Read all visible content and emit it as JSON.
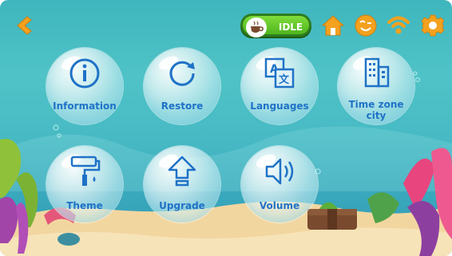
{
  "status": {
    "label": "IDLE",
    "icon": "tea-cup-icon"
  },
  "topbar": {
    "back_icon": "back-chevron-icon",
    "icons": [
      "home-icon",
      "face-icon",
      "wifi-icon",
      "gear-icon"
    ]
  },
  "menu": {
    "items": [
      {
        "label": "Information",
        "icon": "info-icon"
      },
      {
        "label": "Restore",
        "icon": "refresh-icon"
      },
      {
        "label": "Languages",
        "icon": "translate-icon"
      },
      {
        "label": "Time zone city",
        "icon": "building-icon"
      },
      {
        "label": "Theme",
        "icon": "paint-roller-icon"
      },
      {
        "label": "Upgrade",
        "icon": "upgrade-arrow-icon"
      },
      {
        "label": "Volume",
        "icon": "speaker-icon"
      }
    ]
  },
  "colors": {
    "accent": "#1f72c7",
    "status_green": "#4fb51e",
    "icon_orange": "#f3a11e"
  }
}
